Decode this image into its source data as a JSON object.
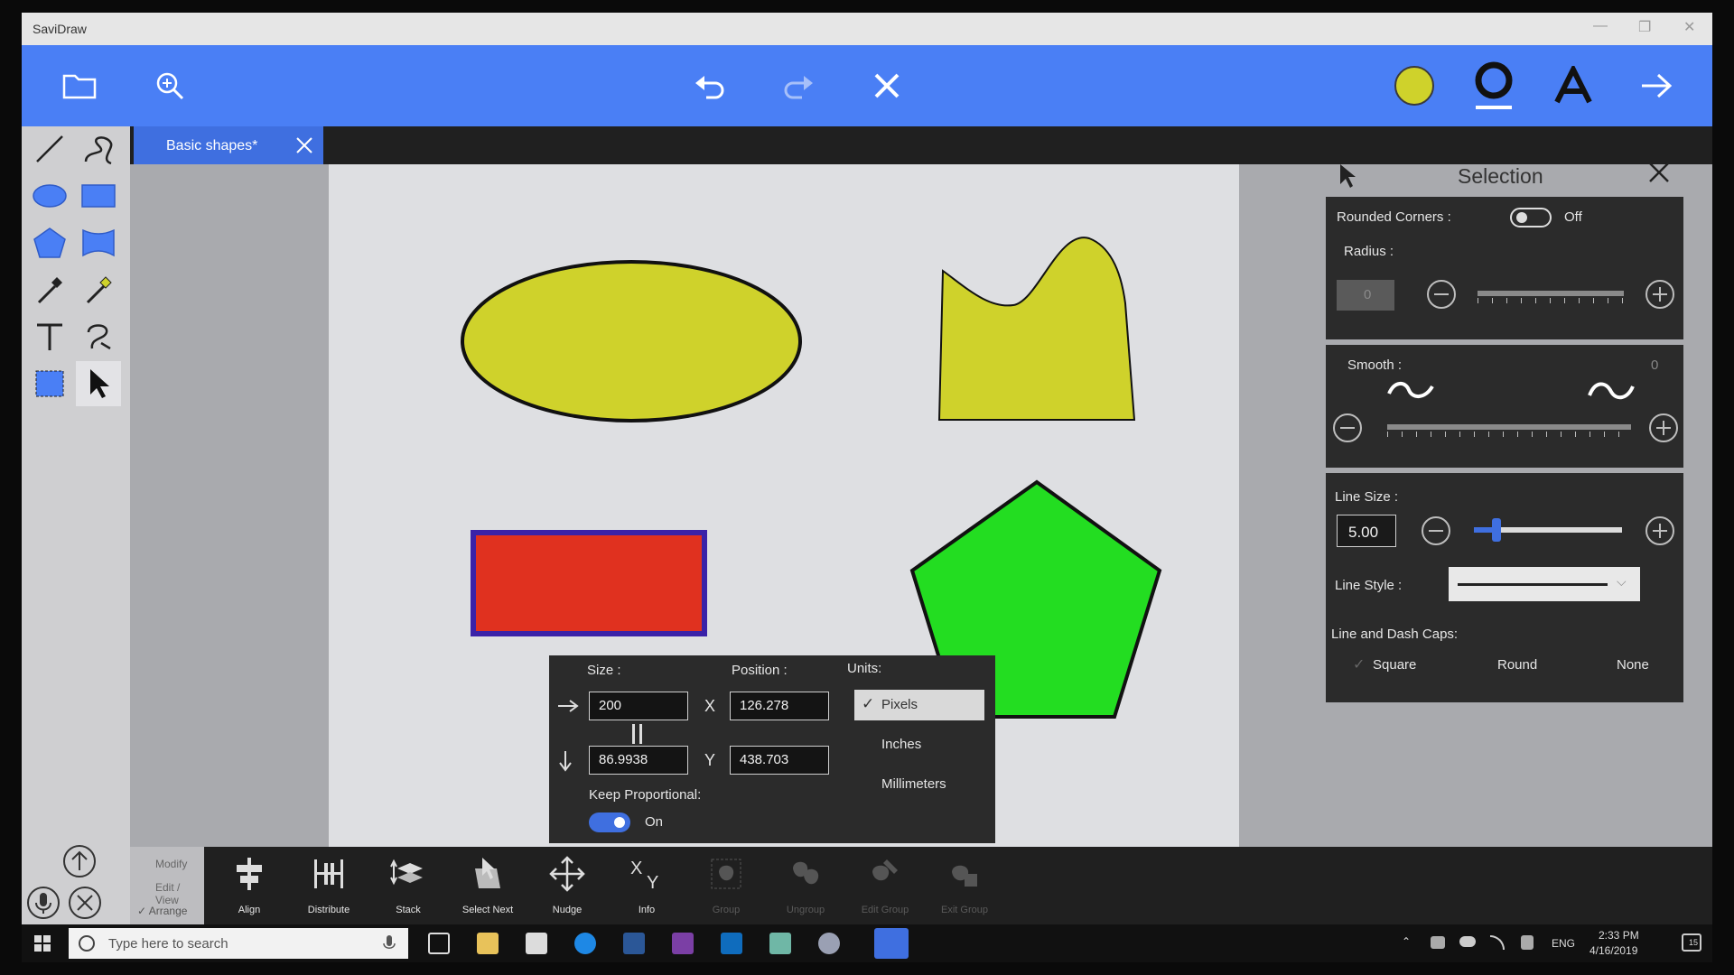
{
  "app": {
    "title": "SaviDraw"
  },
  "colors": {
    "toolbar": "#4a7ff5",
    "fill_color": "#cfd22b",
    "accent_blue": "#3f6fe0"
  },
  "toolbar": {
    "icons": [
      "folder-icon",
      "zoom-icon",
      "undo-icon",
      "redo-icon",
      "delete-icon",
      "fill-color-swatch",
      "stroke-style-icon",
      "text-style-icon",
      "next-arrow-icon"
    ]
  },
  "doc_tab": {
    "label": "Basic shapes*"
  },
  "tools": [
    "line-tool",
    "freehand-tool",
    "ellipse-tool",
    "rectangle-tool",
    "polygon-tool",
    "curved-rect-tool",
    "eyedropper-tool",
    "pen-tool",
    "text-tool",
    "path-tool",
    "lasso-tool",
    "select-tool"
  ],
  "size_panel": {
    "size_label": "Size :",
    "position_label": "Position :",
    "units_label": "Units:",
    "width": "200",
    "height": "86.9938",
    "x_label": "X",
    "y_label": "Y",
    "x": "126.278",
    "y": "438.703",
    "units": [
      "Pixels",
      "Inches",
      "Millimeters"
    ],
    "selected_unit": "Pixels",
    "keep_proportional_label": "Keep Proportional:",
    "keep_proportional_state": "On"
  },
  "selection_panel": {
    "title": "Selection",
    "rounded_corners_label": "Rounded Corners :",
    "rounded_corners_state": "Off",
    "radius_label": "Radius :",
    "radius_value": "0",
    "smooth_label": "Smooth :",
    "smooth_value": "0",
    "line_size_label": "Line Size :",
    "line_size_value": "5.00",
    "line_style_label": "Line Style :",
    "caps_label": "Line and Dash Caps:",
    "caps": [
      "Square",
      "Round",
      "None"
    ],
    "selected_cap": "Square"
  },
  "bottom": {
    "modes": [
      "Modify",
      "Edit / View",
      "Arrange"
    ],
    "selected_mode": "Arrange",
    "commands": [
      "Align",
      "Distribute",
      "Stack",
      "Select Next",
      "Nudge",
      "Info",
      "Group",
      "Ungroup",
      "Edit Group",
      "Exit Group"
    ]
  },
  "taskbar": {
    "search_placeholder": "Type here to search",
    "lang": "ENG",
    "time": "2:33 PM",
    "date": "4/16/2019",
    "notif_count": "15"
  }
}
